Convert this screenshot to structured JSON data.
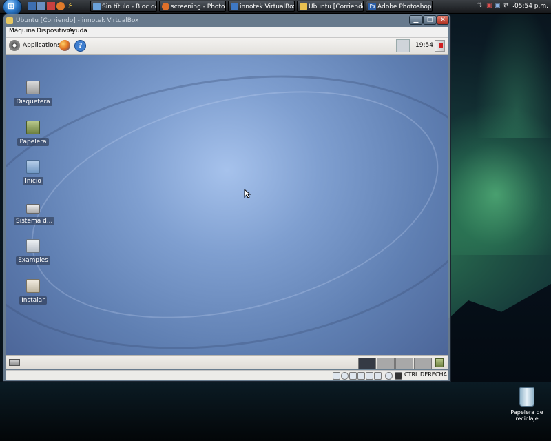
{
  "taskbar": {
    "tasks": [
      {
        "label": "Sin título - Bloc de n...",
        "icon": "notepad-icon",
        "color": "#6aa0d8"
      },
      {
        "label": "screening - Photob...",
        "icon": "firefox-icon",
        "color": "#e0702a"
      },
      {
        "label": "innotek VirtualBox",
        "icon": "virtualbox-icon",
        "color": "#3e78c4"
      },
      {
        "label": "Ubuntu [Corriendo] ...",
        "icon": "virtualbox-vm-icon",
        "color": "#e8c050"
      },
      {
        "label": "Adobe Photoshop C...",
        "icon": "photoshop-icon",
        "color": "#2a5ea8"
      }
    ],
    "clock": "05:54 p.m."
  },
  "desktop": {
    "recycle_bin_label": "Papelera de reciclaje"
  },
  "vbox_window": {
    "title": "Ubuntu [Corriendo] - innotek VirtualBox",
    "menu": [
      "Máquina",
      "Dispositivos",
      "Ayuda"
    ],
    "status_host_key": "CTRL DERECHA"
  },
  "guest": {
    "top_panel": {
      "applications_label": "Applications",
      "clock": "19:54"
    },
    "desktop_icons": [
      {
        "label": "Disquetera",
        "icon": "floppy-drive-icon",
        "color": "#c8c8c8"
      },
      {
        "label": "Papelera",
        "icon": "trash-icon",
        "color": "#9ab06a"
      },
      {
        "label": "Inicio",
        "icon": "home-folder-icon",
        "color": "#8fb4d8"
      },
      {
        "label": "Sistema d...",
        "icon": "filesystem-icon",
        "color": "#d0d0d0"
      },
      {
        "label": "Examples",
        "icon": "examples-folder-icon",
        "color": "#d8dde4"
      },
      {
        "label": "Instalar",
        "icon": "install-icon",
        "color": "#e8e0d0"
      }
    ]
  },
  "colors": {
    "guest_bg": "#7f9fd0",
    "taskbar_bg": "#16181b"
  }
}
